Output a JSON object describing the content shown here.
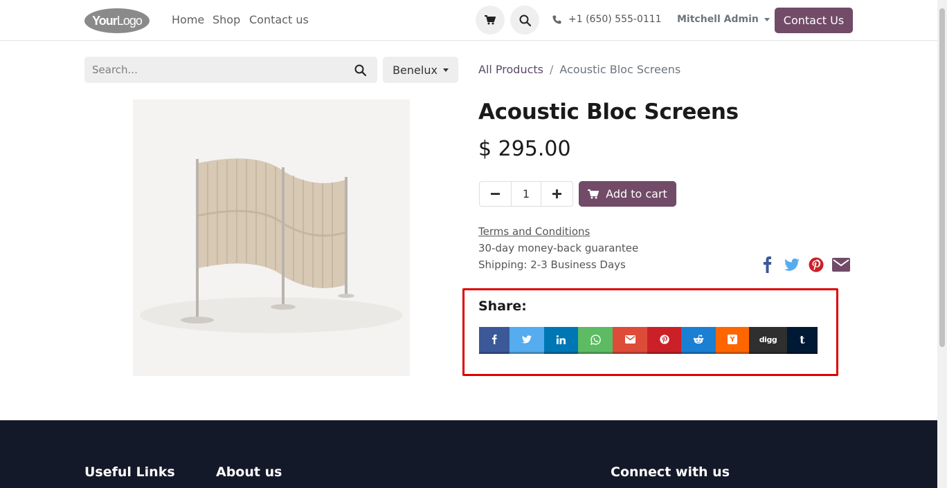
{
  "header": {
    "logo": {
      "bold": "Your",
      "light": "Logo"
    },
    "nav": [
      "Home",
      "Shop",
      "Contact us"
    ],
    "phone": "+1 (650) 555-0111",
    "user": "Mitchell Admin",
    "contact_button": "Contact Us"
  },
  "search": {
    "placeholder": "Search...",
    "value": ""
  },
  "region": "Benelux",
  "breadcrumb": {
    "parent": "All Products",
    "separator": "/",
    "current": "Acoustic Bloc Screens"
  },
  "product": {
    "name": "Acoustic Bloc Screens",
    "price": "$ 295.00",
    "quantity": "1",
    "add_to_cart": "Add to cart",
    "terms": "Terms and Conditions",
    "guarantee": "30-day money-back guarantee",
    "shipping": "Shipping: 2-3 Business Days"
  },
  "share": {
    "label": "Share:",
    "buttons": [
      {
        "name": "facebook",
        "icon": "facebook-icon",
        "color": "#3b5998"
      },
      {
        "name": "twitter",
        "icon": "twitter-icon",
        "color": "#55acee"
      },
      {
        "name": "linkedin",
        "icon": "linkedin-icon",
        "color": "#0077b5"
      },
      {
        "name": "whatsapp",
        "icon": "whatsapp-icon",
        "color": "#5dbb63"
      },
      {
        "name": "email",
        "icon": "email-icon",
        "color": "#dd4b39"
      },
      {
        "name": "pinterest",
        "icon": "pinterest-icon",
        "color": "#cb2027"
      },
      {
        "name": "reddit",
        "icon": "reddit-icon",
        "color": "#1b7fd3"
      },
      {
        "name": "hackernews",
        "icon": "hackernews-icon",
        "color": "#ff6600"
      },
      {
        "name": "digg",
        "icon": "digg-icon",
        "color": "#2f2f2f"
      },
      {
        "name": "tumblr",
        "icon": "tumblr-icon",
        "color": "#001935"
      }
    ],
    "digg_text": "digg",
    "hackernews_text": "Y"
  },
  "colors": {
    "brand": "#714b67",
    "footer": "#141929",
    "highlight": "#e00000"
  },
  "footer": {
    "useful_links": "Useful Links",
    "about": "About us",
    "connect": "Connect with us"
  }
}
